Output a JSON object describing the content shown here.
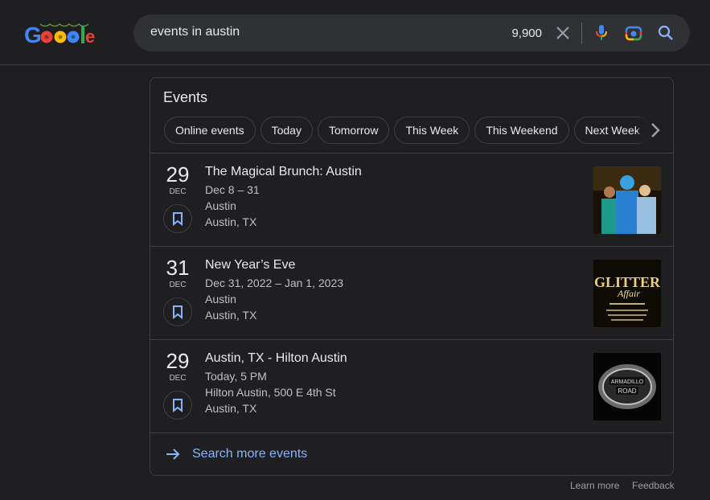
{
  "header": {
    "logo_alt": "Google",
    "search_query": "events in austin",
    "result_count": "9,900",
    "icons": {
      "clear": "close-icon",
      "mic": "microphone-icon",
      "lens": "camera-lens-icon",
      "search": "search-icon"
    }
  },
  "events_card": {
    "title": "Events",
    "chips": [
      "Online events",
      "Today",
      "Tomorrow",
      "This Week",
      "This Weekend",
      "Next Week"
    ],
    "chip_peek": "Nex",
    "items": [
      {
        "day": "29",
        "month": "DEC",
        "title": "The Magical Brunch: Austin",
        "when": "Dec 8 – 31",
        "venue": "Austin",
        "location": "Austin, TX",
        "image": "costumed characters photo"
      },
      {
        "day": "31",
        "month": "DEC",
        "title": "New Year’s Eve",
        "when": "Dec 31, 2022 – Jan 1, 2023",
        "venue": "Austin",
        "location": "Austin, TX",
        "image": "Glitter Affair poster"
      },
      {
        "day": "29",
        "month": "DEC",
        "title": "Austin, TX - Hilton Austin",
        "when": "Today, 5 PM",
        "venue": "Hilton Austin, 500 E 4th St",
        "location": "Austin, TX",
        "image": "Armadillo Road buckle logo"
      }
    ],
    "more_label": "Search more events"
  },
  "footer": {
    "learn_more": "Learn more",
    "feedback": "Feedback"
  },
  "colors": {
    "accent": "#8ab4f8",
    "background": "#1f1f21",
    "border": "#3c4043"
  }
}
